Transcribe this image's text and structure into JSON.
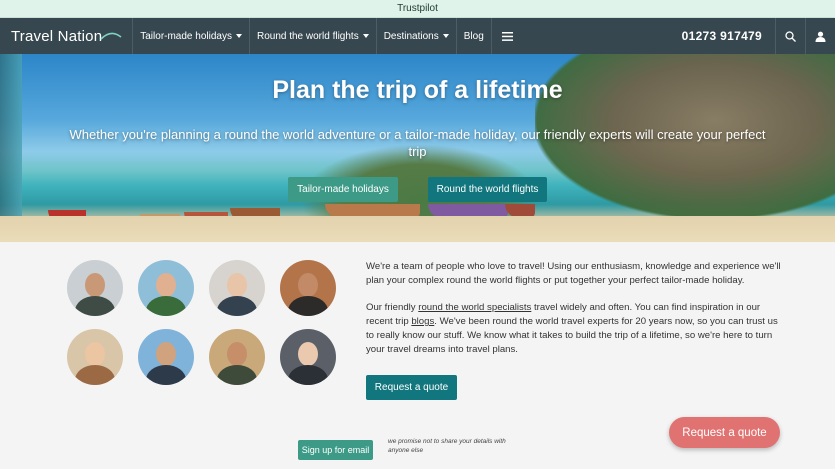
{
  "trustbar": {
    "label": "Trustpilot"
  },
  "nav": {
    "logo": "Travel Nation",
    "items": [
      {
        "label": "Tailor-made holidays",
        "has_dropdown": true
      },
      {
        "label": "Round the world flights",
        "has_dropdown": true
      },
      {
        "label": "Destinations",
        "has_dropdown": true
      },
      {
        "label": "Blog",
        "has_dropdown": false
      }
    ],
    "menu_icon": "hamburger-icon",
    "phone": "01273 917479",
    "search_icon": "search-icon",
    "account_icon": "user-icon"
  },
  "hero": {
    "title": "Plan the trip of a lifetime",
    "subtitle": "Whether you're planning a round the world adventure or a tailor-made holiday, our friendly experts will create your perfect trip",
    "btn_tailor": "Tailor-made holidays",
    "btn_rtw": "Round the world flights"
  },
  "intro": {
    "para1": "We're a team of people who love to travel! Using our enthusiasm, knowledge and experience we'll plan your complex round the world flights or put together your perfect tailor-made holiday.",
    "para2_a": "Our friendly ",
    "para2_link1": "round the world specialists",
    "para2_b": " travel widely and often. You can find inspiration in our recent trip ",
    "para2_link2": "blogs",
    "para2_c": ". We've been round the world travel experts for 20 years now, so you can trust us to really know our stuff. We know what it takes to build the trip of a lifetime, so we're here to turn your travel dreams into travel plans.",
    "quote_button": "Request a quote"
  },
  "newsletter": {
    "button": "Sign up for email",
    "note": "we promise not to share your details with anyone else"
  },
  "floating": {
    "quote_button": "Request a quote"
  },
  "colors": {
    "nav": "#37474f",
    "teal_dark": "#11767d",
    "teal_light": "#3c9a86",
    "coral": "#e07272"
  }
}
